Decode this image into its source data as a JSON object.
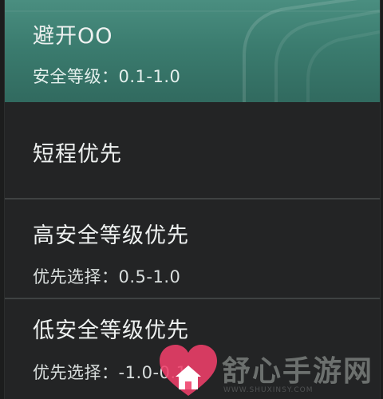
{
  "route_menu": {
    "options": [
      {
        "title": "避开OO",
        "subtitle": "安全等级：0.1-1.0",
        "selected": true
      },
      {
        "title": "短程优先",
        "subtitle": "",
        "selected": false
      },
      {
        "title": "高安全等级优先",
        "subtitle": "优先选择：0.5-1.0",
        "selected": false
      },
      {
        "title": "低安全等级优先",
        "subtitle": "优先选择：-1.0-0.1",
        "selected": false
      }
    ]
  },
  "watermark": {
    "text": "舒心手游网",
    "url": "WWW.SHUXINSY.COM",
    "icon": "heart-house-logo-icon"
  },
  "colors": {
    "selected_bg": "#3d7f72",
    "panel_bg": "#232425",
    "divider": "#3f4242",
    "text": "#eef1f0",
    "logo_pink": "#ef3f6a"
  }
}
